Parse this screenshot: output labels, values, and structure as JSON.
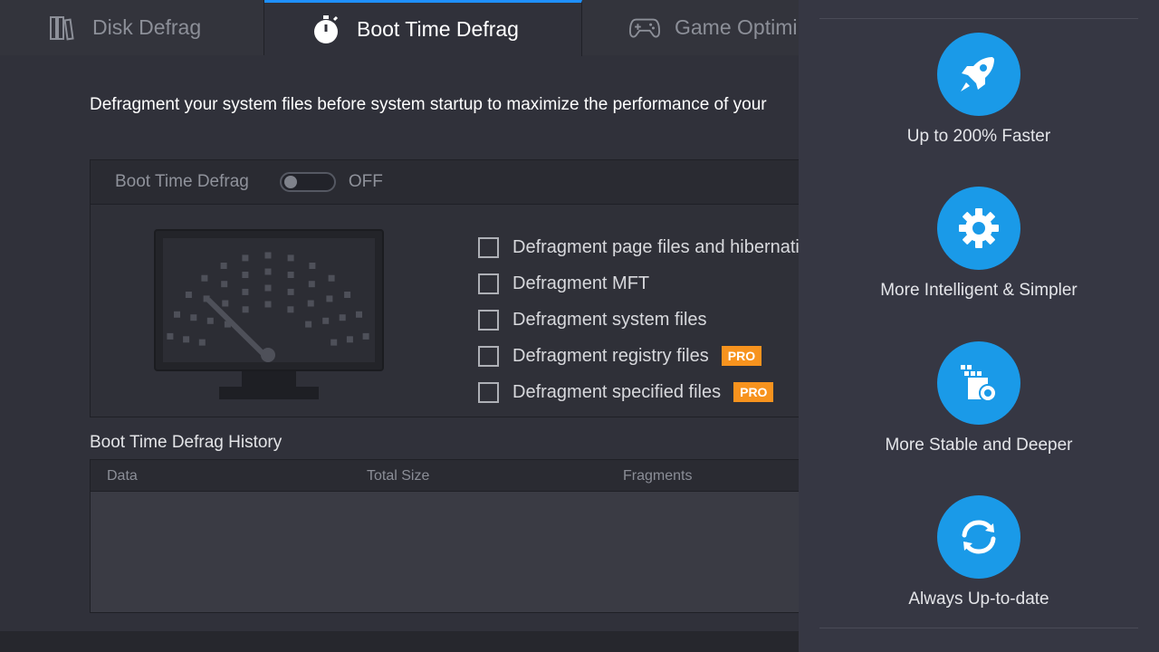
{
  "tabs": [
    {
      "label": "Disk Defrag",
      "icon": "disk-defrag-icon"
    },
    {
      "label": "Boot Time Defrag",
      "icon": "stopwatch-icon",
      "active": true
    },
    {
      "label": "Game Optimi",
      "icon": "gamepad-icon"
    }
  ],
  "description": "Defragment your system files before system startup to maximize the performance of your",
  "boot_box": {
    "title": "Boot Time Defrag",
    "toggle_state": "OFF",
    "options": [
      {
        "label": "Defragment page files and hibernatio",
        "checked": false,
        "pro": false
      },
      {
        "label": "Defragment MFT",
        "checked": false,
        "pro": false
      },
      {
        "label": "Defragment system files",
        "checked": false,
        "pro": false
      },
      {
        "label": "Defragment registry files",
        "checked": false,
        "pro": true
      },
      {
        "label": "Defragment specified files",
        "checked": false,
        "pro": true
      }
    ],
    "pro_badge": "PRO"
  },
  "history": {
    "title": "Boot Time Defrag History",
    "columns": [
      "Data",
      "Total Size",
      "Fragments"
    ]
  },
  "features": [
    {
      "label": "Up to 200% Faster",
      "icon": "rocket-icon"
    },
    {
      "label": "More Intelligent & Simpler",
      "icon": "gear-icon"
    },
    {
      "label": "More Stable and Deeper",
      "icon": "defrag-blocks-icon"
    },
    {
      "label": "Always Up-to-date",
      "icon": "refresh-icon"
    }
  ],
  "colors": {
    "accent": "#1a9ae8",
    "pro": "#f7931e",
    "active_tab_border": "#1e90ff"
  }
}
